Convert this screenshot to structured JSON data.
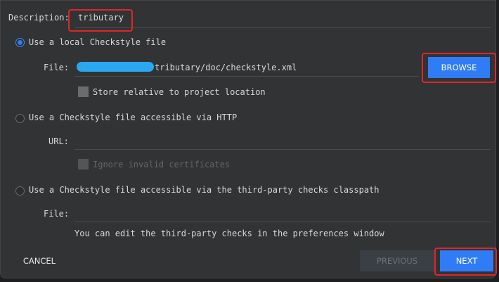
{
  "description": {
    "label": "Description:",
    "value": "tributary"
  },
  "local": {
    "label": "Use a local Checkstyle file",
    "selected": true,
    "file_label": "File:",
    "file_value": "tributary/doc/checkstyle.xml",
    "store_relative": "Store relative to project location",
    "browse": "BROWSE"
  },
  "http": {
    "label": "Use a Checkstyle file accessible via HTTP",
    "url_label": "URL:",
    "url_value": "",
    "ignore_certs": "Ignore invalid certificates"
  },
  "classpath": {
    "label": "Use a Checkstyle file accessible via the third-party checks classpath",
    "file_label": "File:",
    "file_value": "",
    "note": "You can edit the third-party checks in the preferences window"
  },
  "footer": {
    "cancel": "CANCEL",
    "previous": "PREVIOUS",
    "next": "NEXT"
  },
  "colors": {
    "accent": "#2f7cf6",
    "highlight": "#e0262a",
    "redaction": "#29a8f0"
  }
}
